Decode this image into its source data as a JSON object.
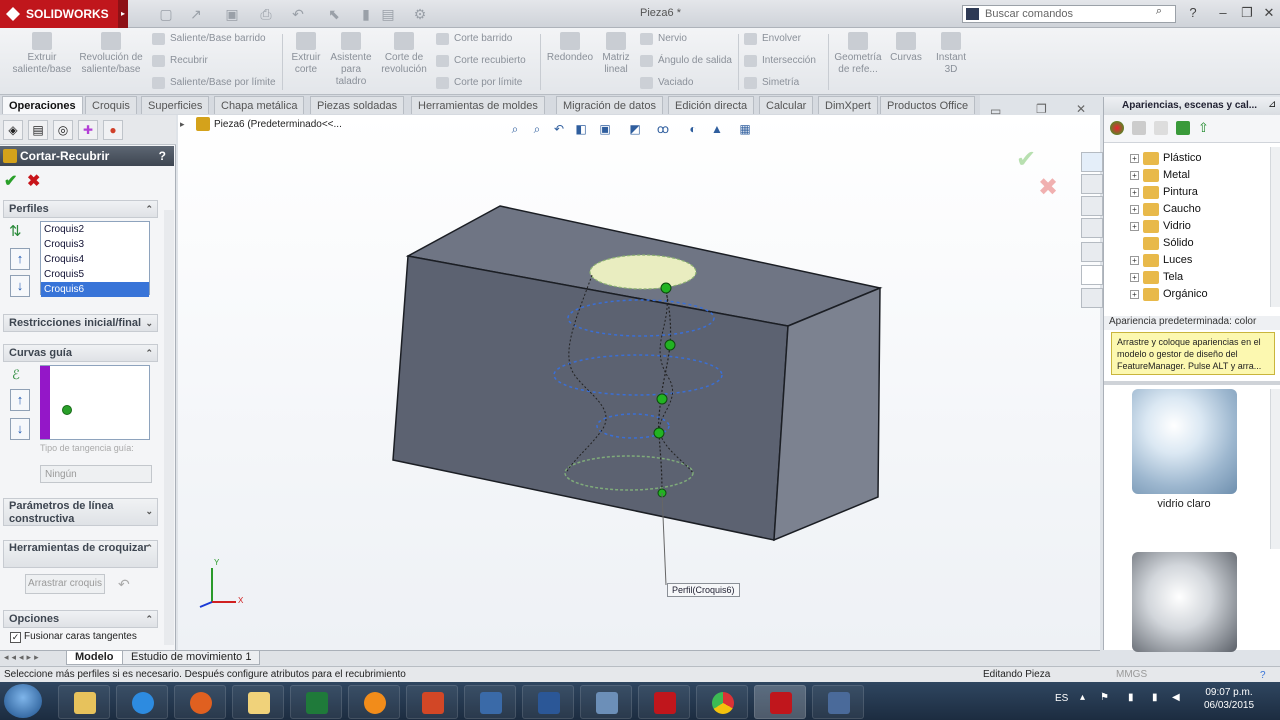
{
  "app": {
    "name": "SOLIDWORKS",
    "doc_title": "Pieza6 *",
    "search_placeholder": "Buscar comandos"
  },
  "ribbon": {
    "big_buttons": [
      "Extruir saliente/base",
      "Revolución de saliente/base",
      "Extruir corte",
      "Asistente para taladro",
      "Corte de revolución",
      "Redondeo",
      "Matriz lineal",
      "Geometría de refe...",
      "Curvas",
      "Instant 3D"
    ],
    "small_buttons": [
      "Saliente/Base barrido",
      "Recubrir",
      "Saliente/Base por límite",
      "Corte barrido",
      "Corte recubierto",
      "Corte por límite",
      "Nervio",
      "Ángulo de salida",
      "Vaciado",
      "Envolver",
      "Intersección",
      "Simetría"
    ]
  },
  "tabs": [
    "Operaciones",
    "Croquis",
    "Superficies",
    "Chapa metálica",
    "Piezas soldadas",
    "Herramientas de moldes",
    "Migración de datos",
    "Edición directa",
    "Calcular",
    "DimXpert",
    "Productos Office"
  ],
  "property_manager": {
    "title": "Cortar-Recubrir",
    "help": "?",
    "ok_icon": "✔",
    "cancel_icon": "✖",
    "sections": {
      "perfiles": "Perfiles",
      "restricciones": "Restricciones inicial/final",
      "curvas_guia": "Curvas guía",
      "tangencia_label": "Tipo de tangencia guía:",
      "tangencia_value": "Ningún",
      "parametros": "Parámetros de línea constructiva",
      "herramientas": "Herramientas de croquizar",
      "arrastrar": "Arrastrar croquis",
      "opciones": "Opciones",
      "fusionar": "Fusionar caras tangentes"
    },
    "profiles": [
      "Croquis2",
      "Croquis3",
      "Croquis4",
      "Croquis5",
      "Croquis6"
    ]
  },
  "viewport": {
    "tree_label": "Pieza6  (Predeterminado<<...",
    "callout": "Perfil(Croquis6)",
    "axes": {
      "y": "Y",
      "x": "X"
    }
  },
  "appearances": {
    "title": "Apariencias, escenas y cal...",
    "tree": [
      "Plástico",
      "Metal",
      "Pintura",
      "Caucho",
      "Vidrio",
      "Sólido",
      "Luces",
      "Tela",
      "Orgánico"
    ],
    "default_label": "Apariencia predeterminada: color",
    "tooltip": "Arrastre y coloque apariencias en el modelo o gestor de diseño del FeatureManager. Pulse ALT y arra...",
    "material1": "vidrio claro"
  },
  "bottom_tabs": [
    "Modelo",
    "Estudio de movimiento 1"
  ],
  "status": {
    "left": "Seleccione más perfiles si es necesario. Después configure atributos para el recubrimiento",
    "right": "Editando Pieza",
    "units": "MMGS"
  },
  "taskbar": {
    "lang": "ES",
    "time": "09:07 p.m.",
    "date": "06/03/2015"
  },
  "colors": {
    "brand": "#c0161c",
    "selection": "#3874d8",
    "part": "#6c7484"
  }
}
